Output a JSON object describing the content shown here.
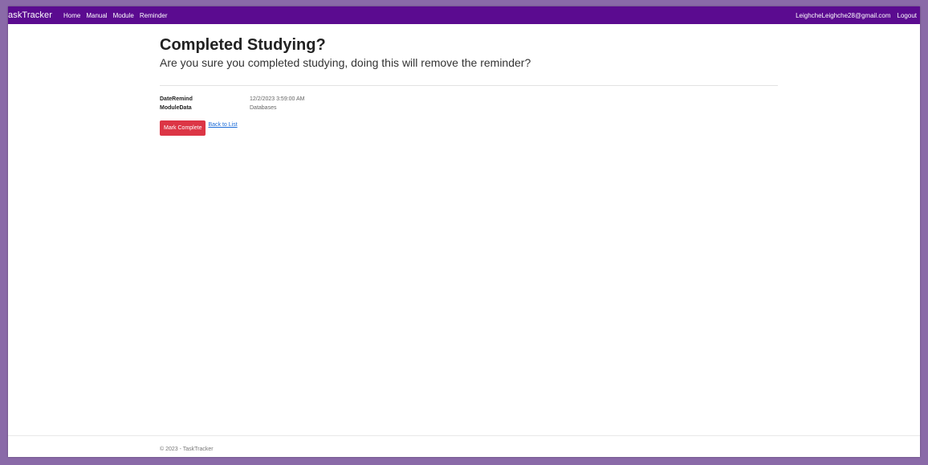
{
  "navbar": {
    "brand": "askTracker",
    "links": [
      "Home",
      "Manual",
      "Module",
      "Reminder"
    ],
    "user": "LeighcheLeighche28@gmail.com",
    "logout": "Logout"
  },
  "page": {
    "title": "Completed Studying?",
    "subtitle": "Are you sure you completed studying, doing this will remove the reminder?"
  },
  "details": [
    {
      "label": "DateRemind",
      "value": "12/2/2023 3:59:00 AM"
    },
    {
      "label": "ModuleData",
      "value": "Databases"
    }
  ],
  "actions": {
    "complete_label": "Mark Complete",
    "back_label": "Back to List"
  },
  "footer": {
    "text": "© 2023 - TaskTracker"
  },
  "colors": {
    "navbar": "#5b0b90",
    "frame": "#8a6aa8",
    "danger": "#dc3545",
    "link": "#1a6bd8"
  }
}
